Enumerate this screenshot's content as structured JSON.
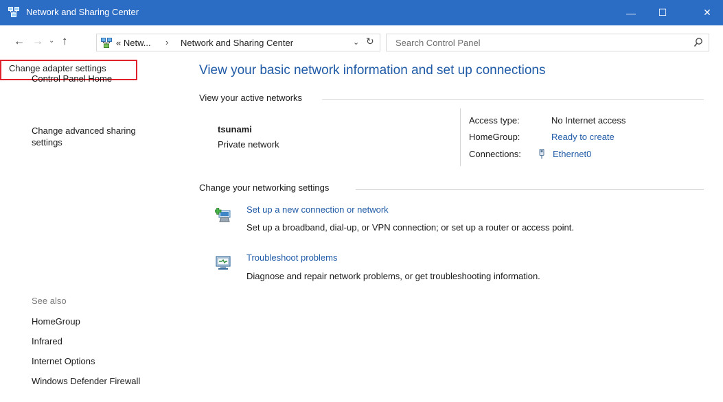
{
  "window": {
    "title": "Network and Sharing Center",
    "controls": {
      "minimize": "—",
      "maximize": "☐",
      "close": "✕"
    },
    "accent_color": "#2b6cc4"
  },
  "navigation": {
    "back": "←",
    "forward": "→",
    "recent": "⌄",
    "up": "↑",
    "address": {
      "crumb_overflow": "« Netw...",
      "separator": "›",
      "current": "Network and Sharing Center",
      "dropdown": "⌄",
      "refresh": "↻"
    },
    "search": {
      "placeholder": "Search Control Panel"
    }
  },
  "sidebar": {
    "home": "Control Panel Home",
    "change_adapter": "Change adapter settings",
    "change_advanced": "Change advanced sharing settings",
    "see_also_header": "See also",
    "see_also": [
      "HomeGroup",
      "Infrared",
      "Internet Options",
      "Windows Defender Firewall"
    ],
    "highlight_color": "#e0202a"
  },
  "main": {
    "title": "View your basic network information and set up connections",
    "active_networks_header": "View your active networks",
    "network": {
      "name": "tsunami",
      "type": "Private network",
      "access_type_label": "Access type:",
      "access_type_value": "No Internet access",
      "homegroup_label": "HomeGroup:",
      "homegroup_value": "Ready to create",
      "connections_label": "Connections:",
      "connections_value": "Ethernet0"
    },
    "change_settings_header": "Change your networking settings",
    "tasks": [
      {
        "icon": "new-connection-icon",
        "link": "Set up a new connection or network",
        "description": "Set up a broadband, dial-up, or VPN connection; or set up a router or access point."
      },
      {
        "icon": "troubleshoot-icon",
        "link": "Troubleshoot problems",
        "description": "Diagnose and repair network problems, or get troubleshooting information."
      }
    ],
    "link_color": "#1f5aa6"
  }
}
